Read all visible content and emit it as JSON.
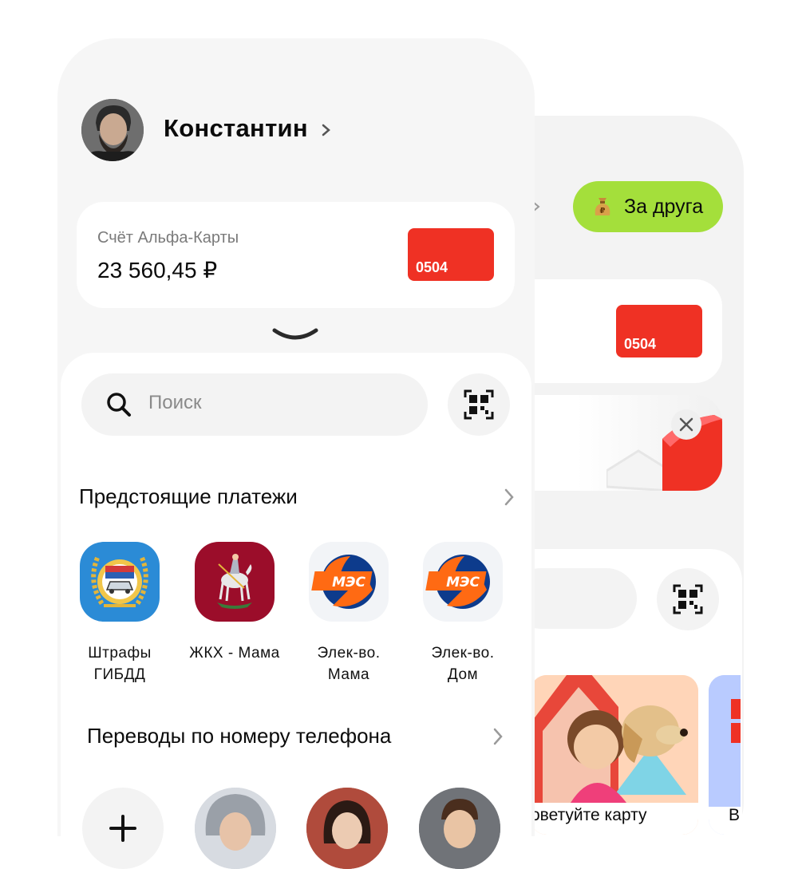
{
  "front": {
    "user": {
      "name": "Константин"
    },
    "account": {
      "label": "Счёт Альфа-Карты",
      "balance_int": "23 560",
      "balance_dec": ",45 ₽",
      "card_last4": "0504"
    },
    "search": {
      "placeholder": "Поиск"
    },
    "upcoming": {
      "title": "Предстоящие платежи",
      "items": [
        {
          "line1": "Штрафы",
          "line2": "ГИБДД"
        },
        {
          "line1": "ЖКХ - Мама",
          "line2": ""
        },
        {
          "line1": "Элек-во.",
          "line2": "Мама"
        },
        {
          "line1": "Элек-во.",
          "line2": "Дом"
        }
      ]
    },
    "transfers": {
      "title": "Переводы по номеру телефона"
    },
    "mes_logo_text": "МЭС"
  },
  "back": {
    "promo_button": "За друга",
    "card_last4": "0504",
    "promo_card_text": "оветуйте карту",
    "promo_card2_text": "В"
  },
  "colors": {
    "accent_red": "#ef3124",
    "promo_green": "#a4df3b",
    "gibdd_blue": "#2b8bd6",
    "mos_red": "#9b0d2a",
    "mes_orange": "#ff6a13",
    "mes_blue": "#0d3b8c"
  }
}
